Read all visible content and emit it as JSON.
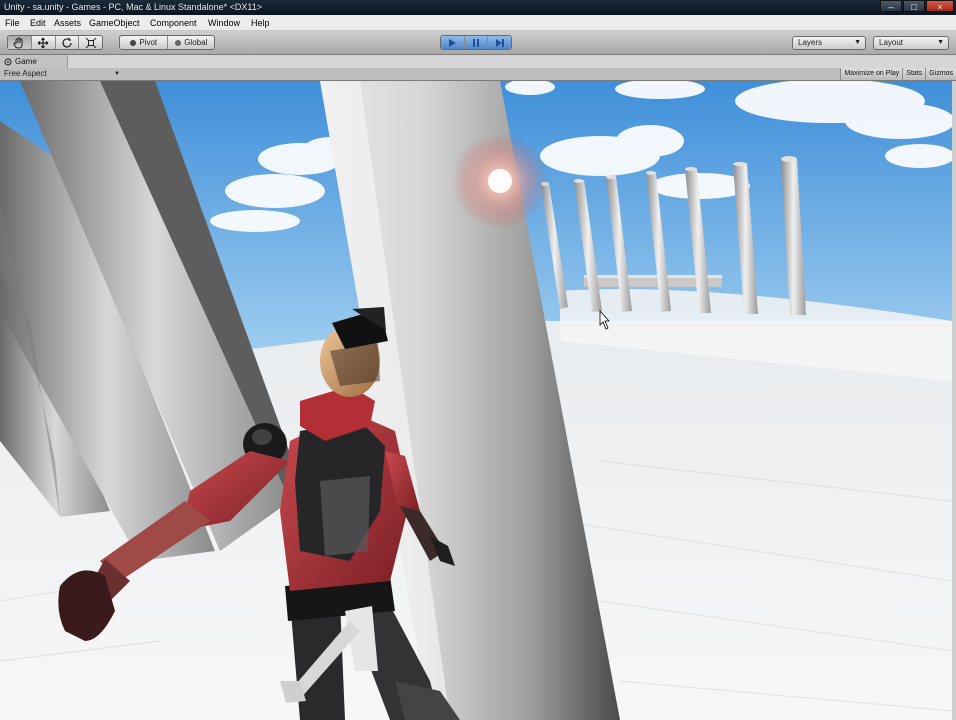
{
  "window": {
    "title": "Unity - sa.unity - Games - PC, Mac & Linux Standalone* <DX11>",
    "minimize_glyph": "–",
    "maximize_glyph": "□",
    "close_glyph": "×"
  },
  "menu": [
    "File",
    "Edit",
    "Assets",
    "GameObject",
    "Component",
    "Window",
    "Help"
  ],
  "toolbar": {
    "tools": [
      "hand-icon",
      "move-icon",
      "rotate-icon",
      "scale-icon"
    ],
    "pivot_label": "Pivot",
    "global_label": "Global",
    "playback": [
      "play-icon",
      "pause-icon",
      "step-icon"
    ],
    "layers_label": "Layers",
    "layout_label": "Layout",
    "accent_color": "#4f86c6"
  },
  "game_view": {
    "tab_label": "Game",
    "aspect_label": "Free Aspect",
    "buttons": [
      "Maximize on Play",
      "Stats",
      "Gizmos"
    ]
  },
  "scene": {
    "sky_color": "#5aa6e6",
    "ground_color": "#f2f2f2",
    "character_suit_color": "#b3333a"
  }
}
